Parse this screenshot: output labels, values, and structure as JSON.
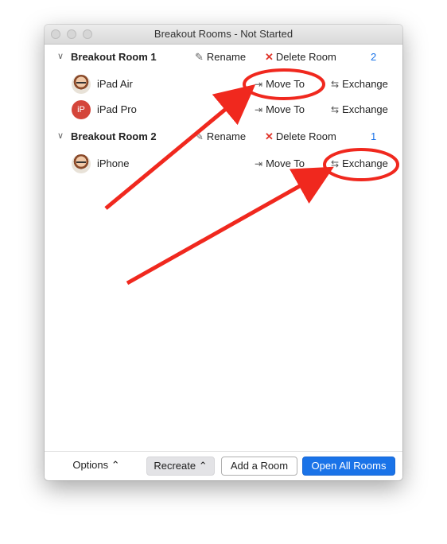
{
  "window": {
    "title": "Breakout Rooms - Not Started"
  },
  "rooms": [
    {
      "name": "Breakout Room 1",
      "rename_label": "Rename",
      "delete_label": "Delete Room",
      "count": "2",
      "participants": [
        {
          "name": "iPad Air",
          "avatar": "photo",
          "move_label": "Move To",
          "exchange_label": "Exchange"
        },
        {
          "name": "iPad Pro",
          "avatar": "initials",
          "initials": "iP",
          "move_label": "Move To",
          "exchange_label": "Exchange"
        }
      ]
    },
    {
      "name": "Breakout Room 2",
      "rename_label": "Rename",
      "delete_label": "Delete Room",
      "count": "1",
      "participants": [
        {
          "name": "iPhone",
          "avatar": "photo",
          "move_label": "Move To",
          "exchange_label": "Exchange"
        }
      ]
    }
  ],
  "footer": {
    "options_label": "Options",
    "recreate_label": "Recreate",
    "add_room_label": "Add a Room",
    "open_all_label": "Open All Rooms"
  },
  "colors": {
    "accent": "#1a73e8",
    "delete": "#e0352b",
    "annotation": "#f0281e"
  },
  "icons": [
    "chevron-down-icon",
    "pencil-icon",
    "x-icon",
    "move-to-icon",
    "exchange-icon",
    "chevron-up-icon"
  ]
}
